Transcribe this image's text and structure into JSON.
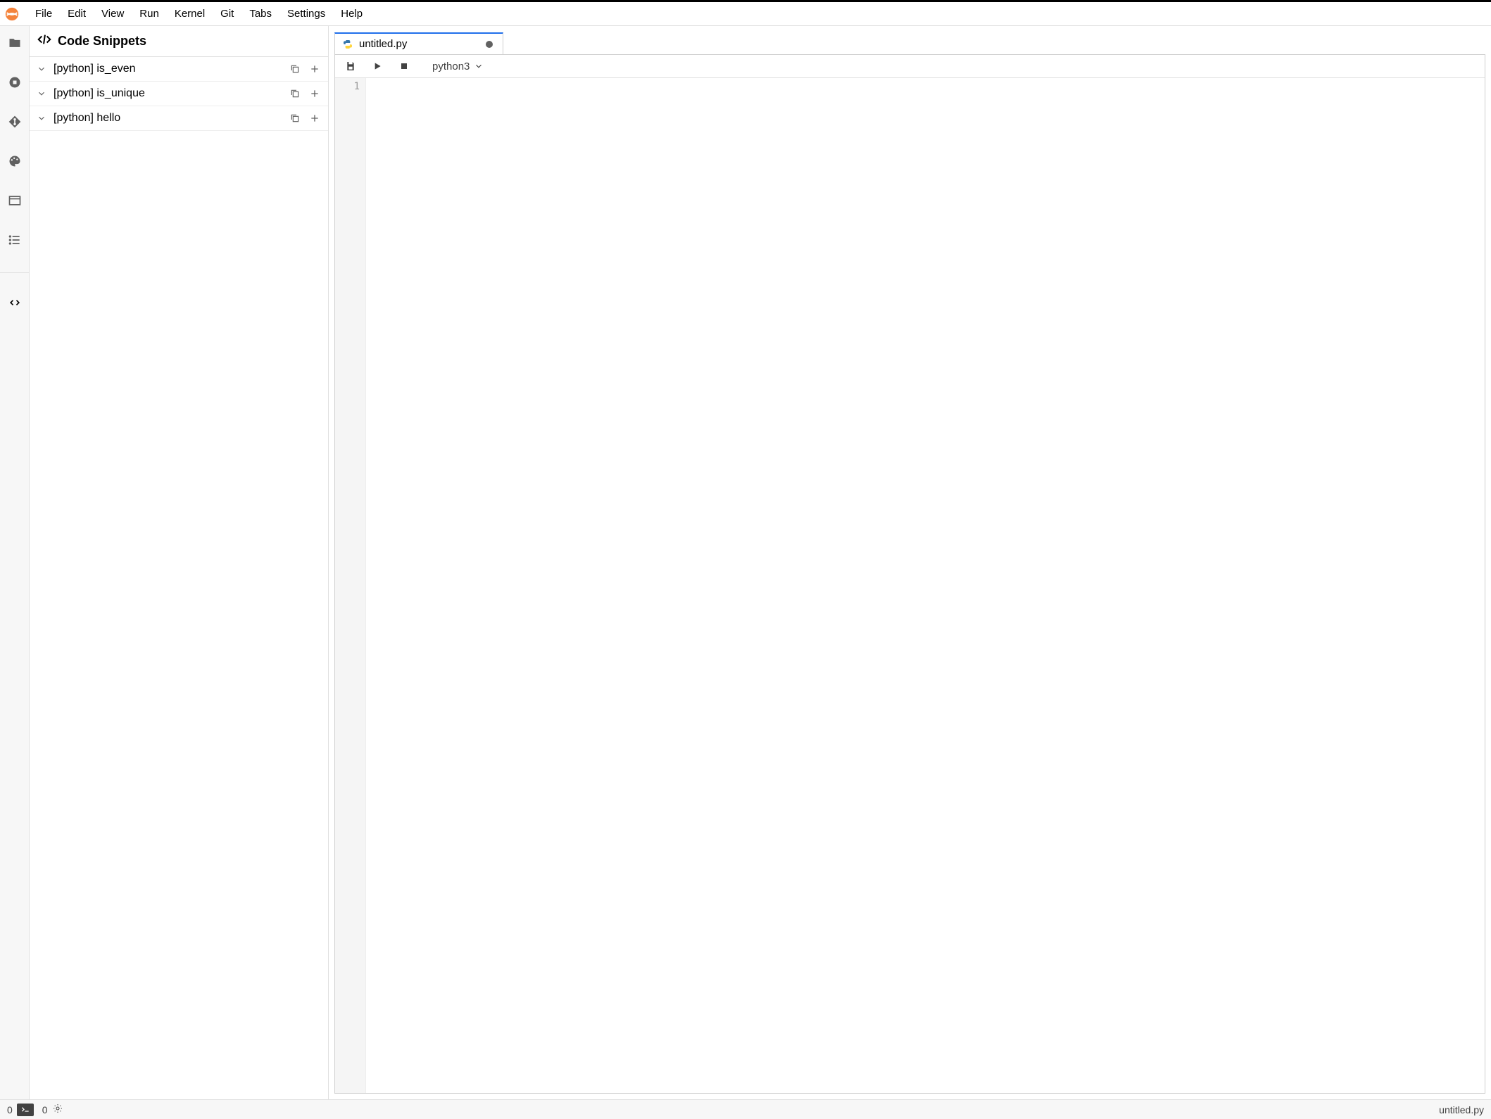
{
  "menubar": {
    "items": [
      "File",
      "Edit",
      "View",
      "Run",
      "Kernel",
      "Git",
      "Tabs",
      "Settings",
      "Help"
    ]
  },
  "sidepanel": {
    "title": "Code Snippets",
    "snippets": [
      {
        "label": "[python] is_even"
      },
      {
        "label": "[python] is_unique"
      },
      {
        "label": "[python] hello"
      }
    ]
  },
  "editor": {
    "tab_label": "untitled.py",
    "dirty": true,
    "kernel_label": "python3",
    "gutter_lines": [
      "1"
    ],
    "code_content": ""
  },
  "statusbar": {
    "left_count_a": "0",
    "left_count_b": "0",
    "right_file": "untitled.py"
  }
}
